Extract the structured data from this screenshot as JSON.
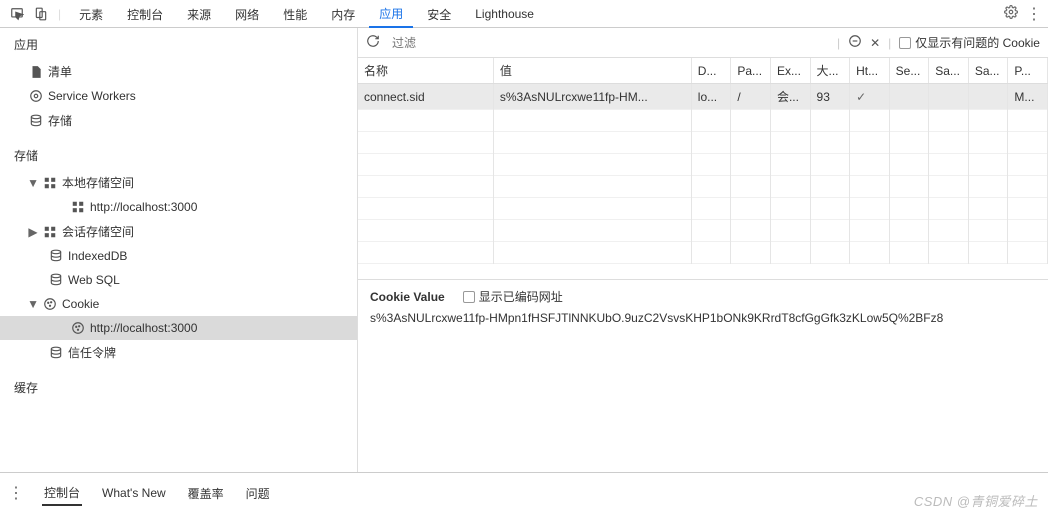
{
  "tabs": {
    "elements": "元素",
    "console": "控制台",
    "sources": "来源",
    "network": "网络",
    "performance": "性能",
    "memory": "内存",
    "application": "应用",
    "security": "安全",
    "lighthouse": "Lighthouse"
  },
  "sidebar": {
    "appSection": "应用",
    "manifest": "清单",
    "serviceWorkers": "Service Workers",
    "storageItem": "存储",
    "storageSection": "存储",
    "localStorage": "本地存储空间",
    "localUrl": "http://localhost:3000",
    "sessionStorage": "会话存储空间",
    "indexedDB": "IndexedDB",
    "webSQL": "Web SQL",
    "cookies": "Cookie",
    "cookieUrl": "http://localhost:3000",
    "trustTokens": "信任令牌",
    "cacheSection": "缓存"
  },
  "toolbar": {
    "filterPlaceholder": "过滤",
    "onlyIssues": "仅显示有问题的 Cookie"
  },
  "columns": {
    "name": "名称",
    "value": "值",
    "domain": "D...",
    "path": "Pa...",
    "expires": "Ex...",
    "size": "大...",
    "httpOnly": "Ht...",
    "secure": "Se...",
    "sameSite": "Sa...",
    "sameParty": "Sa...",
    "priority": "P..."
  },
  "row": {
    "name": "connect.sid",
    "value": "s%3AsNULrcxwe11fp-HM...",
    "domain": "lo...",
    "path": "/",
    "expires": "会...",
    "size": "93",
    "httpOnly": "✓",
    "secure": "",
    "sameSite": "",
    "sameParty": "",
    "priority": "M..."
  },
  "detail": {
    "title": "Cookie Value",
    "showDecoded": "显示已编码网址",
    "value": "s%3AsNULrcxwe11fp-HMpn1fHSFJTlNNKUbO.9uzC2VsvsKHP1bONk9KRrdT8cfGgGfk3zKLow5Q%2BFz8"
  },
  "drawer": {
    "console": "控制台",
    "whatsNew": "What's New",
    "coverage": "覆盖率",
    "issues": "问题"
  },
  "watermark": "CSDN @青铜爱碎土"
}
